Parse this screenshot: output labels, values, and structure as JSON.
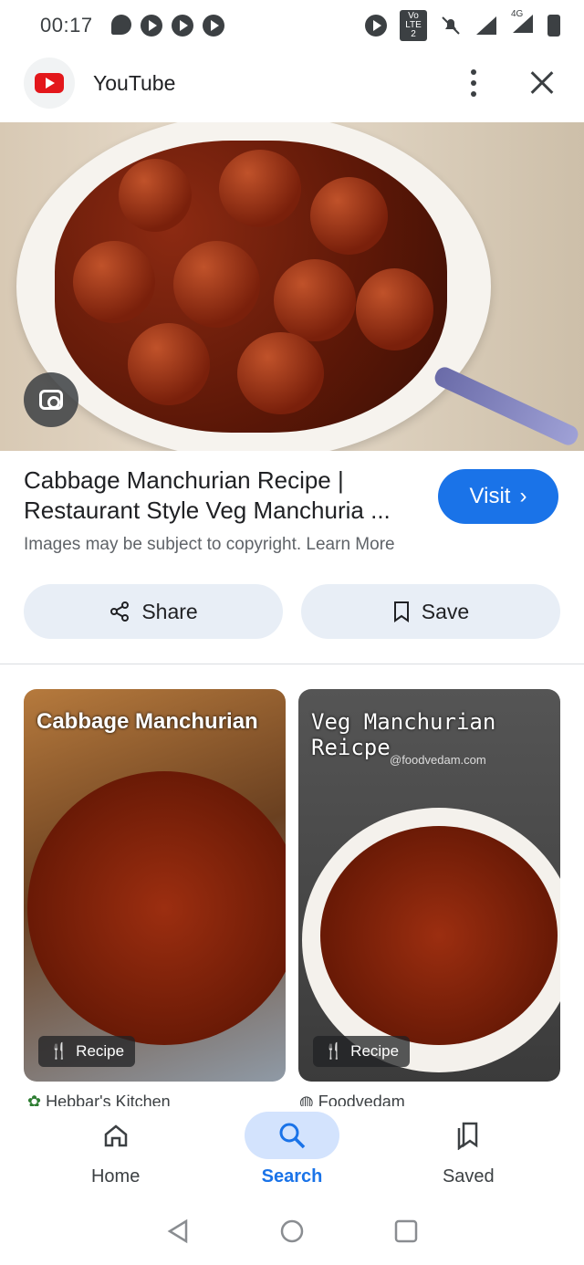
{
  "status_bar": {
    "time": "00:17",
    "network": "4G",
    "volte_label": "Vo LTE 2"
  },
  "header": {
    "site_name": "YouTube",
    "brand_color": "#e3171b"
  },
  "result": {
    "title": "Cabbage Manchurian Recipe | Restaurant Style Veg Manchuria ...",
    "visit_label": "Visit",
    "copyright_text": "Images may be subject to copyright. Learn More"
  },
  "actions": {
    "share_label": "Share",
    "save_label": "Save"
  },
  "related": [
    {
      "overlay_title": "Cabbage Manchurian",
      "badge": "Recipe",
      "source": "Hebbar's Kitchen"
    },
    {
      "overlay_title": "Veg Manchurian Reicpe",
      "overlay_sub": "@foodvedam.com",
      "badge": "Recipe",
      "source": "Foodvedam"
    }
  ],
  "bottom_nav": {
    "items": [
      {
        "label": "Home",
        "icon": "home-icon"
      },
      {
        "label": "Search",
        "icon": "search-icon",
        "active": true
      },
      {
        "label": "Saved",
        "icon": "saved-icon"
      }
    ],
    "accent": "#1a73e8"
  }
}
